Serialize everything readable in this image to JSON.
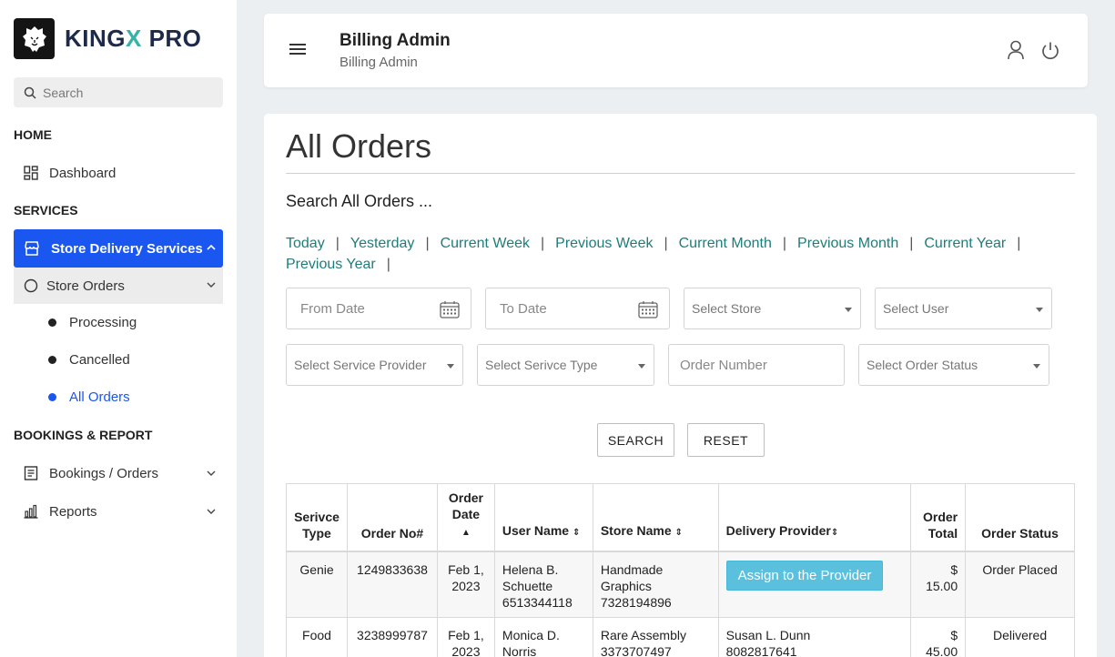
{
  "brand": {
    "name_prefix": "KING",
    "name_x": "X",
    "name_suffix": " PRO"
  },
  "sidebar": {
    "search_placeholder": "Search",
    "sections": {
      "home": "HOME",
      "services": "SERVICES",
      "bookings": "BOOKINGS & REPORT"
    },
    "dashboard": "Dashboard",
    "store_delivery": "Store Delivery Services",
    "store_orders": "Store Orders",
    "sub_items": [
      "Processing",
      "Cancelled",
      "All Orders"
    ],
    "bookings_orders": "Bookings / Orders",
    "reports": "Reports"
  },
  "header": {
    "title": "Billing Admin",
    "subtitle": "Billing Admin"
  },
  "main": {
    "title": "All Orders",
    "search_heading": "Search All Orders ...",
    "quick_links": [
      "Today",
      "Yesterday",
      "Current Week",
      "Previous Week",
      "Current Month",
      "Previous Month",
      "Current Year",
      "Previous Year"
    ],
    "filters": {
      "from_date": "From Date",
      "to_date": "To Date",
      "select_store": "Select Store",
      "select_user": "Select User",
      "select_service_provider": "Select Service Provider",
      "select_service_type": "Select Serivce Type",
      "order_number": "Order Number",
      "select_order_status": "Select Order Status"
    },
    "buttons": {
      "search": "SEARCH",
      "reset": "RESET"
    }
  },
  "table": {
    "headers": {
      "service_type_1": "Serivce",
      "service_type_2": "Type",
      "order_no": "Order No#",
      "order_date_1": "Order",
      "order_date_2": "Date",
      "user_name": "User Name",
      "store_name": "Store Name",
      "delivery_provider": "Delivery Provider",
      "order_total_1": "Order",
      "order_total_2": "Total",
      "order_status": "Order Status"
    },
    "rows": [
      {
        "service_type": "Genie",
        "order_no": "1249833638",
        "date_1": "Feb 1,",
        "date_2": "2023",
        "user_1": "Helena B.",
        "user_2": "Schuette",
        "user_3": "6513344118",
        "store_1": "Handmade",
        "store_2": "Graphics",
        "store_3": "7328194896",
        "provider_button": "Assign to the Provider",
        "total": "$ 15.00",
        "status": "Order Placed"
      },
      {
        "service_type": "Food",
        "order_no": "3238999787",
        "date_1": "Feb 1,",
        "date_2": "2023",
        "user_1": "Monica D.",
        "user_2": "Norris",
        "store_1": "Rare Assembly",
        "store_2": "3373707497",
        "provider_1": "Susan L. Dunn",
        "provider_2": "8082817641",
        "total_1": "$",
        "total_2": "45.00",
        "status": "Delivered"
      }
    ]
  }
}
